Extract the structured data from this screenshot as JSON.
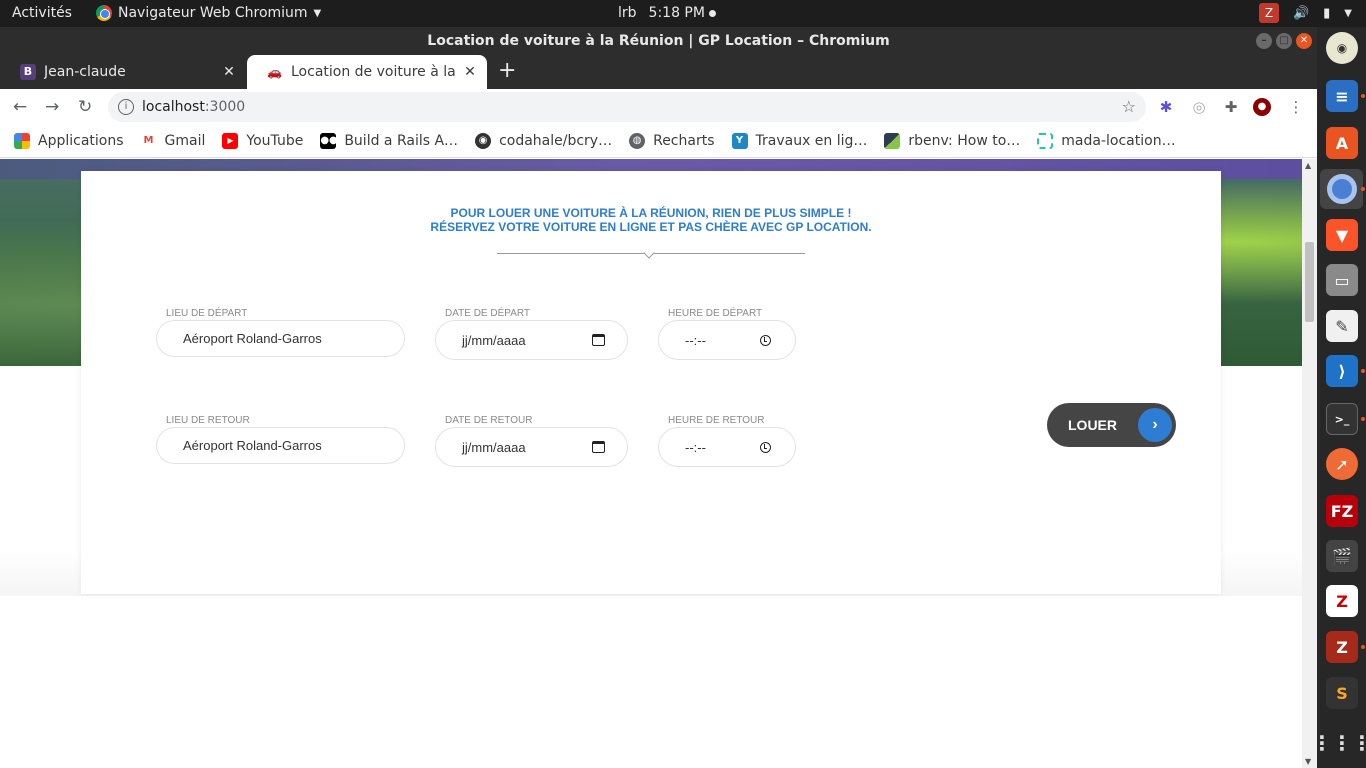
{
  "topbar": {
    "activities": "Activités",
    "app_menu": "Navigateur Web Chromium",
    "user": "lrb",
    "time": "5:18 PM"
  },
  "window": {
    "title": "Location de voiture à la Réunion | GP Location – Chromium"
  },
  "tabs": [
    {
      "label": "Jean-claude",
      "active": false
    },
    {
      "label": "Location de voiture à la Réunion | GP Location",
      "active": true
    }
  ],
  "omnibox": {
    "host": "localhost",
    "port": ":3000"
  },
  "bookmarks": [
    {
      "label": "Applications",
      "icon": "apps-grid-icon"
    },
    {
      "label": "Gmail",
      "icon": "gmail-icon"
    },
    {
      "label": "YouTube",
      "icon": "youtube-icon"
    },
    {
      "label": "Build a Rails A…",
      "icon": "medium-icon"
    },
    {
      "label": "codahale/bcry…",
      "icon": "github-icon"
    },
    {
      "label": "Recharts",
      "icon": "globe-icon"
    },
    {
      "label": "Travaux en lig…",
      "icon": "flag-icon"
    },
    {
      "label": "rbenv: How to…",
      "icon": "bookmark-icon"
    },
    {
      "label": "mada-location…",
      "icon": "dashed-square-icon"
    }
  ],
  "page": {
    "headline_line1": "POUR LOUER UNE VOITURE À LA RÉUNION, RIEN DE PLUS SIMPLE !",
    "headline_line2": "RÉSERVEZ VOTRE VOITURE EN LIGNE ET PAS CHÈRE AVEC GP LOCATION.",
    "form": {
      "departure_place_label": "LIEU DE DÉPART",
      "departure_place_value": "Aéroport Roland-Garros",
      "departure_date_label": "DATE DE DÉPART",
      "departure_date_placeholder": "jj/mm/aaaa",
      "departure_time_label": "HEURE DE DÉPART",
      "departure_time_placeholder": "--:--",
      "return_place_label": "LIEU DE RETOUR",
      "return_place_value": "Aéroport Roland-Garros",
      "return_date_label": "DATE DE RETOUR",
      "return_date_placeholder": "jj/mm/aaaa",
      "return_time_label": "HEURE DE RETOUR",
      "return_time_placeholder": "--:--",
      "submit_label": "LOUER"
    }
  },
  "colors": {
    "accent_blue": "#2d7dd2",
    "button_dark": "#454545",
    "ubuntu_orange": "#e95420"
  }
}
